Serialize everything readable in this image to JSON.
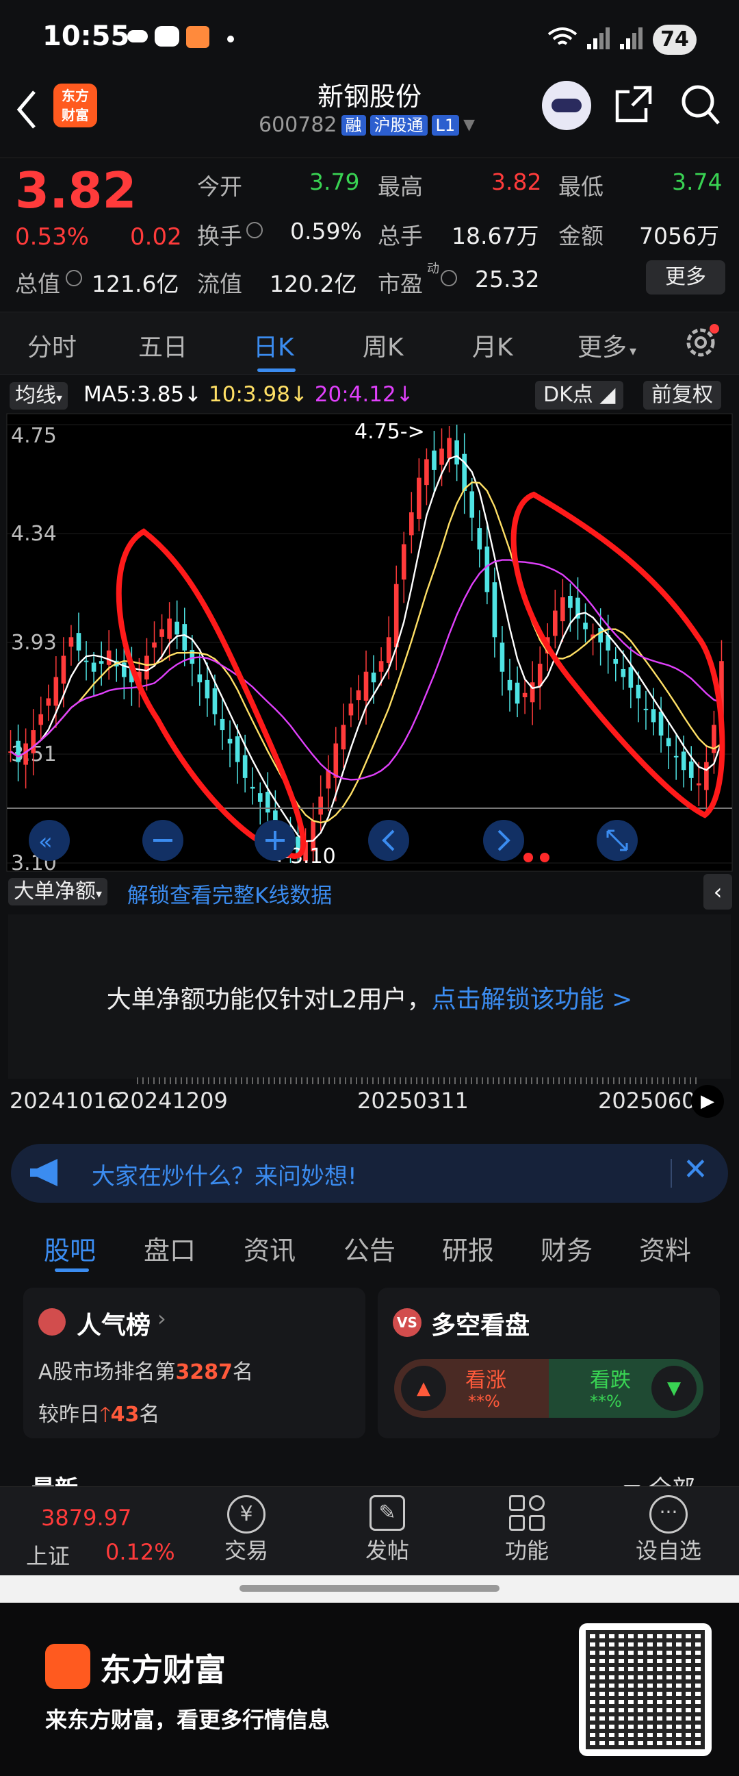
{
  "status": {
    "time": "10:55",
    "battery": "74"
  },
  "header": {
    "logo_text_1": "东方",
    "logo_text_2": "财富",
    "name": "新钢股份",
    "code": "600782",
    "tags": [
      "融",
      "沪股通",
      "L1"
    ]
  },
  "quote": {
    "price": "3.82",
    "change_pct": "0.53%",
    "change": "0.02",
    "open_label": "今开",
    "open": "3.79",
    "high_label": "最高",
    "high": "3.82",
    "low_label": "最低",
    "low": "3.74",
    "turnover_label": "换手",
    "turnover": "0.59%",
    "volume_label": "总手",
    "volume": "18.67万",
    "amount_label": "金额",
    "amount": "7056万",
    "mcap_label": "总值",
    "mcap": "121.6亿",
    "float_label": "流值",
    "float": "120.2亿",
    "pe_label": "市盈",
    "pe_sup": "动",
    "pe": "25.32",
    "more": "更多"
  },
  "period_tabs": [
    "分时",
    "五日",
    "日K",
    "周K",
    "月K",
    "更多"
  ],
  "chart_bar": {
    "ma_chip": "均线",
    "ma5": "MA5:3.85",
    "ma10": "10:3.98",
    "ma20": "20:4.12",
    "dk": "DK点",
    "adjust": "前复权"
  },
  "chart_data": {
    "type": "candlestick",
    "y_ticks": [
      "4.75",
      "4.34",
      "3.93",
      "3.51",
      "3.10"
    ],
    "ylim": [
      3.1,
      4.75
    ],
    "annotation_high": "4.75->",
    "annotation_low": "<-3.10",
    "x_dates": [
      "20241016",
      "20241209",
      "20250311",
      "2025060"
    ],
    "close_series": [
      3.52,
      3.48,
      3.55,
      3.6,
      3.66,
      3.72,
      3.8,
      3.88,
      3.95,
      3.9,
      3.86,
      3.82,
      3.85,
      3.9,
      3.84,
      3.8,
      3.78,
      3.82,
      3.88,
      3.93,
      3.98,
      4.02,
      3.96,
      3.9,
      3.85,
      3.78,
      3.72,
      3.66,
      3.6,
      3.55,
      3.48,
      3.42,
      3.38,
      3.33,
      3.29,
      3.25,
      3.2,
      3.16,
      3.12,
      3.18,
      3.26,
      3.35,
      3.45,
      3.55,
      3.62,
      3.7,
      3.75,
      3.82,
      3.78,
      3.86,
      3.95,
      4.15,
      4.3,
      4.42,
      4.55,
      4.62,
      4.58,
      4.66,
      4.7,
      4.6,
      4.5,
      4.4,
      4.28,
      4.12,
      3.95,
      3.82,
      3.75,
      3.7,
      3.74,
      3.78,
      3.85,
      3.95,
      4.05,
      4.1,
      4.06,
      4.02,
      3.98,
      3.96,
      3.93,
      3.9,
      3.85,
      3.8,
      3.76,
      3.72,
      3.68,
      3.63,
      3.58,
      3.54,
      3.5,
      3.45,
      3.42,
      3.4,
      3.48,
      3.62,
      3.86
    ],
    "ma_colors": {
      "ma5": "#ffffff",
      "ma10": "#ffe066",
      "ma20": "#e040fb"
    }
  },
  "subchart": {
    "label": "大单净额",
    "unlock_link": "解锁查看完整K线数据",
    "lock_text": "大单净额功能仅针对L2用户，",
    "lock_link": "点击解锁该功能 >"
  },
  "chat_banner": {
    "text": "大家在炒什么？来问妙想!"
  },
  "content_tabs": [
    "股吧",
    "盘口",
    "资讯",
    "公告",
    "研报",
    "财务",
    "资料"
  ],
  "popularity": {
    "title": "人气榜",
    "rank_prefix": "A股市场排名第",
    "rank": "3287",
    "rank_suffix": "名",
    "change_prefix": "较昨日",
    "change": "43",
    "change_suffix": "名"
  },
  "sentiment": {
    "title": "多空看盘",
    "bull": "看涨",
    "bull_pct": "**%",
    "bear": "看跌",
    "bear_pct": "**%"
  },
  "sort_row": {
    "left": "最新",
    "right": "全部"
  },
  "bottom_nav": {
    "index_value": "3879.97",
    "index_name": "上证",
    "index_pct": "0.12%",
    "items": [
      "交易",
      "发帖",
      "功能",
      "设自选"
    ]
  },
  "footer": {
    "brand": "东方财富",
    "slogan": "来东方财富，看更多行情信息"
  }
}
